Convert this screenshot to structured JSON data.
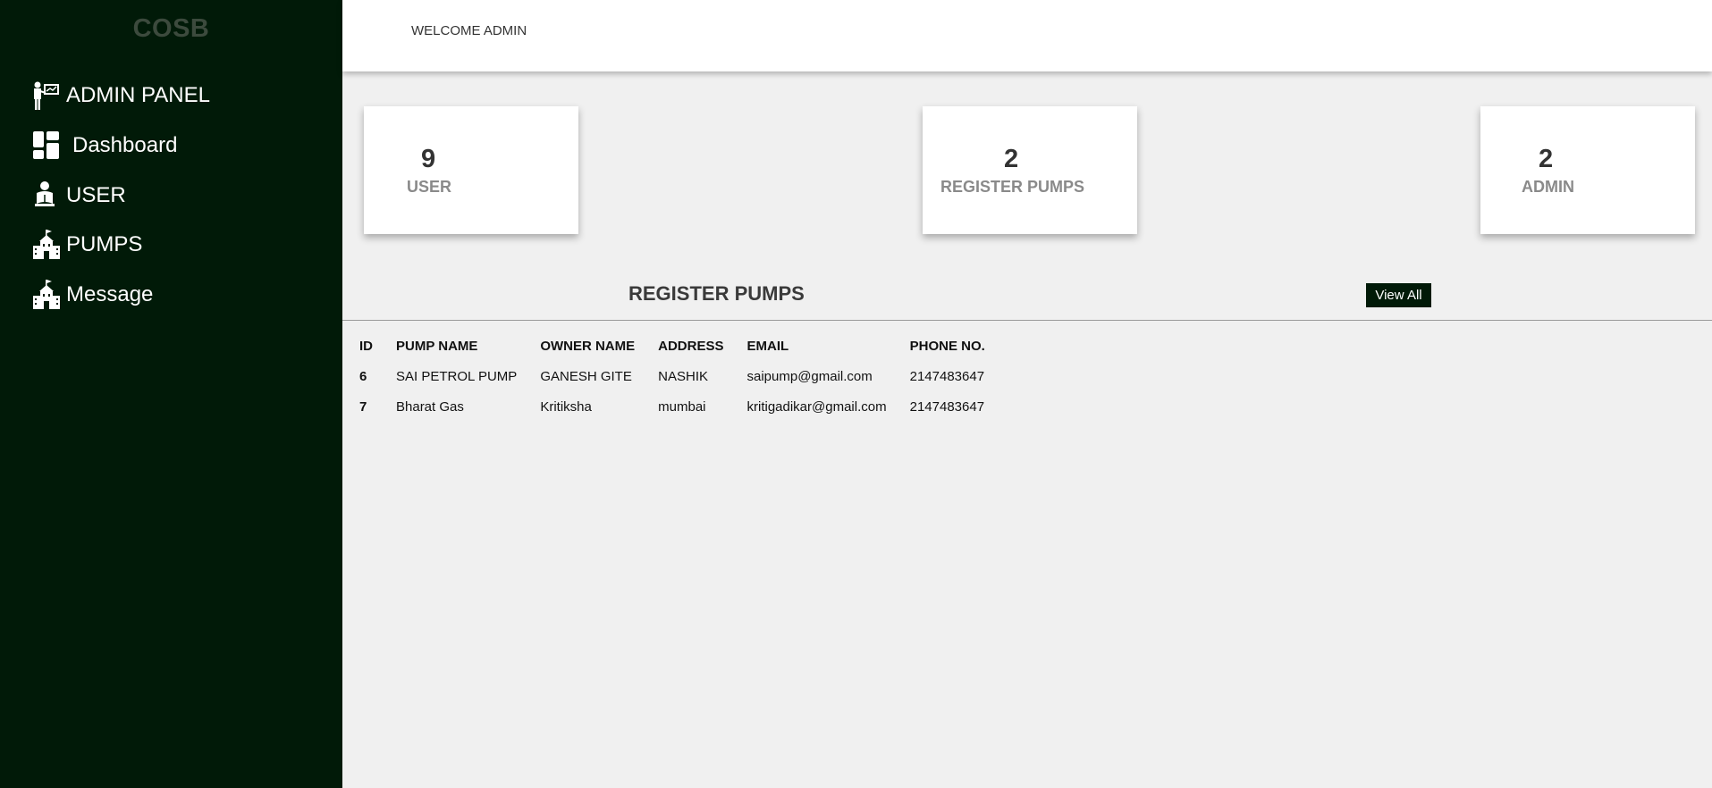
{
  "sidebar": {
    "brand": "COSB",
    "items": [
      {
        "label": "ADMIN PANEL",
        "icon": "presenter-icon"
      },
      {
        "label": "Dashboard",
        "icon": "dashboard-grid-icon"
      },
      {
        "label": "USER",
        "icon": "user-reading-icon"
      },
      {
        "label": "PUMPS",
        "icon": "building-icon"
      },
      {
        "label": "Message",
        "icon": "building-icon"
      }
    ]
  },
  "header": {
    "welcome": "WELCOME ADMIN"
  },
  "cards": [
    {
      "value": "9",
      "label": "USER"
    },
    {
      "value": "2",
      "label": "REGISTER PUMPS"
    },
    {
      "value": "2",
      "label": "ADMIN"
    }
  ],
  "pumps_section": {
    "title": "REGISTER PUMPS",
    "view_all_label": "View All",
    "columns": [
      "ID",
      "PUMP NAME",
      "OWNER NAME",
      "ADDRESS",
      "EMAIL",
      "PHONE NO."
    ],
    "rows": [
      {
        "id": "6",
        "pump_name": "SAI PETROL PUMP",
        "owner_name": "GANESH GITE",
        "address": "NASHIK",
        "email": "saipump@gmail.com",
        "phone": "2147483647"
      },
      {
        "id": "7",
        "pump_name": "Bharat Gas",
        "owner_name": "Kritiksha",
        "address": "mumbai",
        "email": "kritigadikar@gmail.com",
        "phone": "2147483647"
      }
    ]
  },
  "colors": {
    "sidebar_bg": "#011a08",
    "brand_text": "#3c4a3d",
    "content_bg": "#f0f0f0"
  }
}
